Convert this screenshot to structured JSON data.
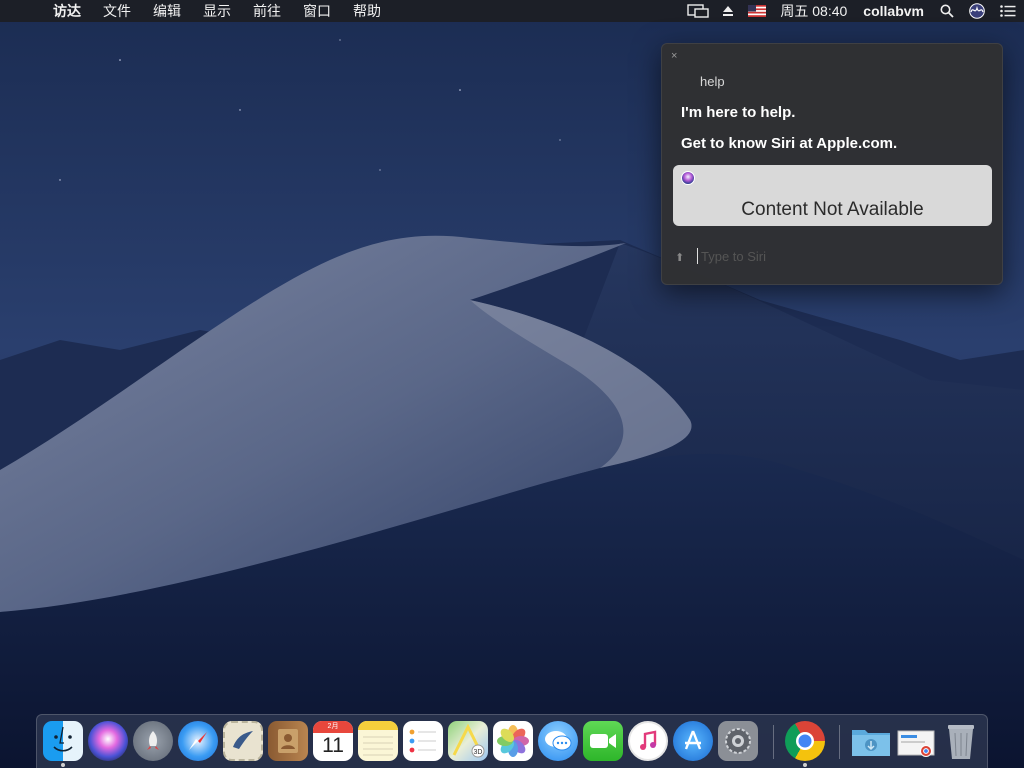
{
  "menubar": {
    "apple_glyph": "",
    "items": [
      "访达",
      "文件",
      "编辑",
      "显示",
      "前往",
      "窗口",
      "帮助"
    ],
    "clock": "周五 08:40",
    "user": "collabvm",
    "status_icons": [
      "screen-mirroring-icon",
      "eject-icon",
      "us-flag-input-icon",
      "spotlight-icon",
      "siri-icon",
      "notification-center-icon"
    ]
  },
  "siri": {
    "close_glyph": "×",
    "query": "help",
    "response_line1": "I'm here to help.",
    "response_line2": "Get to know Siri at Apple.com.",
    "card_text": "Content Not Available",
    "input_placeholder": "Type to Siri",
    "mic_glyph": "⬆"
  },
  "dock": {
    "calendar_month": "2月",
    "calendar_day": "11",
    "apps": [
      "Finder",
      "Siri",
      "Launchpad",
      "Safari",
      "Mail",
      "Contacts",
      "Calendar",
      "Notes",
      "Reminders",
      "Maps",
      "Photos",
      "Messages",
      "FaceTime",
      "iTunes",
      "App Store",
      "System Preferences",
      "Google Chrome",
      "Downloads",
      "Preview",
      "Trash"
    ]
  },
  "colors": {
    "menubar_bg": "#1c1e24",
    "siri_panel_bg": "#303032",
    "siri_card_bg": "#d9d9d9"
  }
}
